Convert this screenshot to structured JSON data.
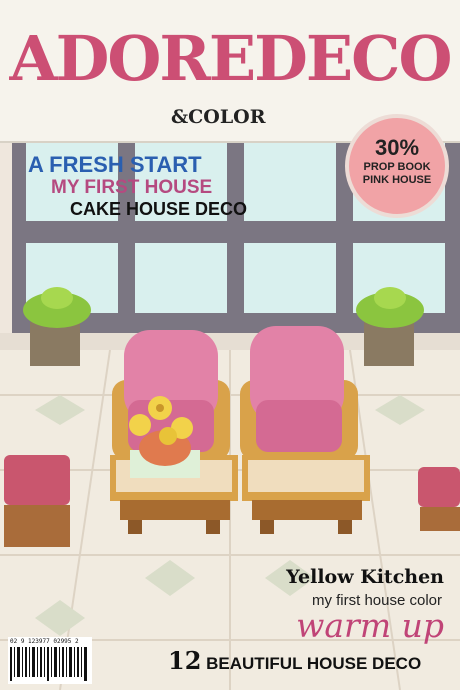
{
  "magazine": {
    "title": "ADOREDECO",
    "subtitle": "&COLOR"
  },
  "badge": {
    "percent": "30%",
    "line1": "PROP BOOK",
    "line2": "PINK HOUSE",
    "color": "#f1a3a6"
  },
  "headlines": {
    "line1": "A FRESH START",
    "line2": "MY FIRST HOUSE",
    "line3": "CAKE HOUSE DECO"
  },
  "bottom": {
    "line1": "Yellow Kitchen",
    "line2": "my first house color",
    "line3": "warm up",
    "number": "12",
    "line4": "BEAUTIFUL HOUSE DECO"
  },
  "barcode": {
    "digits": "02 9 123977   02995 2"
  },
  "colors": {
    "brand": "#cc4f74",
    "blue_headline": "#2a5fb0",
    "pink_headline": "#b54a80"
  }
}
